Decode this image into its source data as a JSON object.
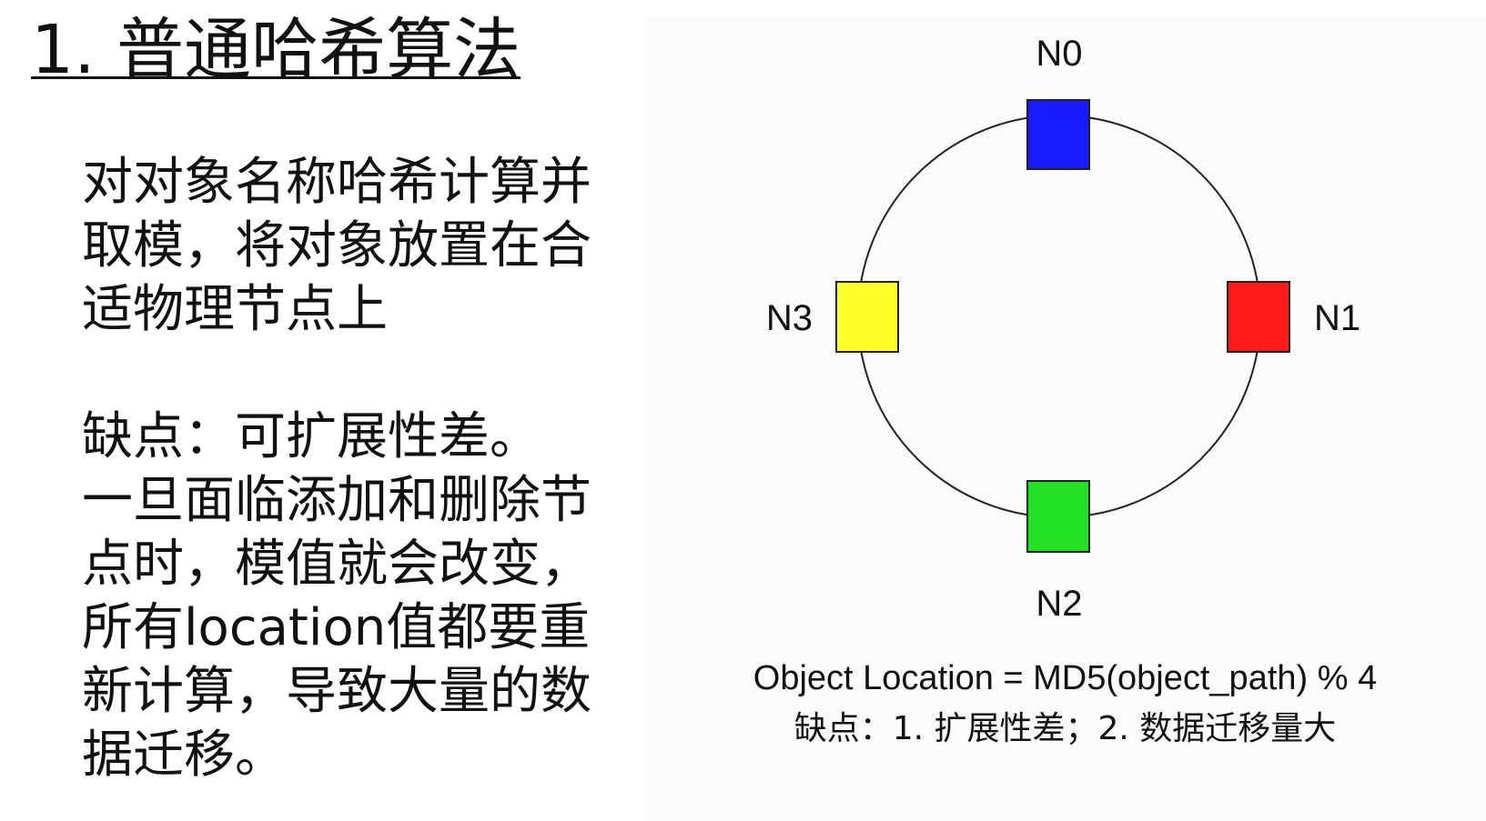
{
  "title": "1. 普通哈希算法",
  "body": {
    "description_lines": [
      "对对象名称哈希计算并",
      "取模，将对象放置在合",
      "适物理节点上"
    ],
    "drawback_lines": [
      "缺点：可扩展性差。",
      "一旦面临添加和删除节",
      "点时，模值就会改变，",
      "所有location值都要重",
      "新计算，导致大量的数",
      "据迁移。"
    ]
  },
  "diagram": {
    "nodes": [
      {
        "label": "N0",
        "color": "#1a1aff",
        "position": "top"
      },
      {
        "label": "N1",
        "color": "#ff1a1a",
        "position": "right"
      },
      {
        "label": "N2",
        "color": "#22e022",
        "position": "bottom"
      },
      {
        "label": "N3",
        "color": "#ffff2a",
        "position": "left"
      }
    ],
    "formula": "Object Location = MD5(object_path) % 4",
    "note": "缺点：1. 扩展性差；2. 数据迁移量大"
  }
}
